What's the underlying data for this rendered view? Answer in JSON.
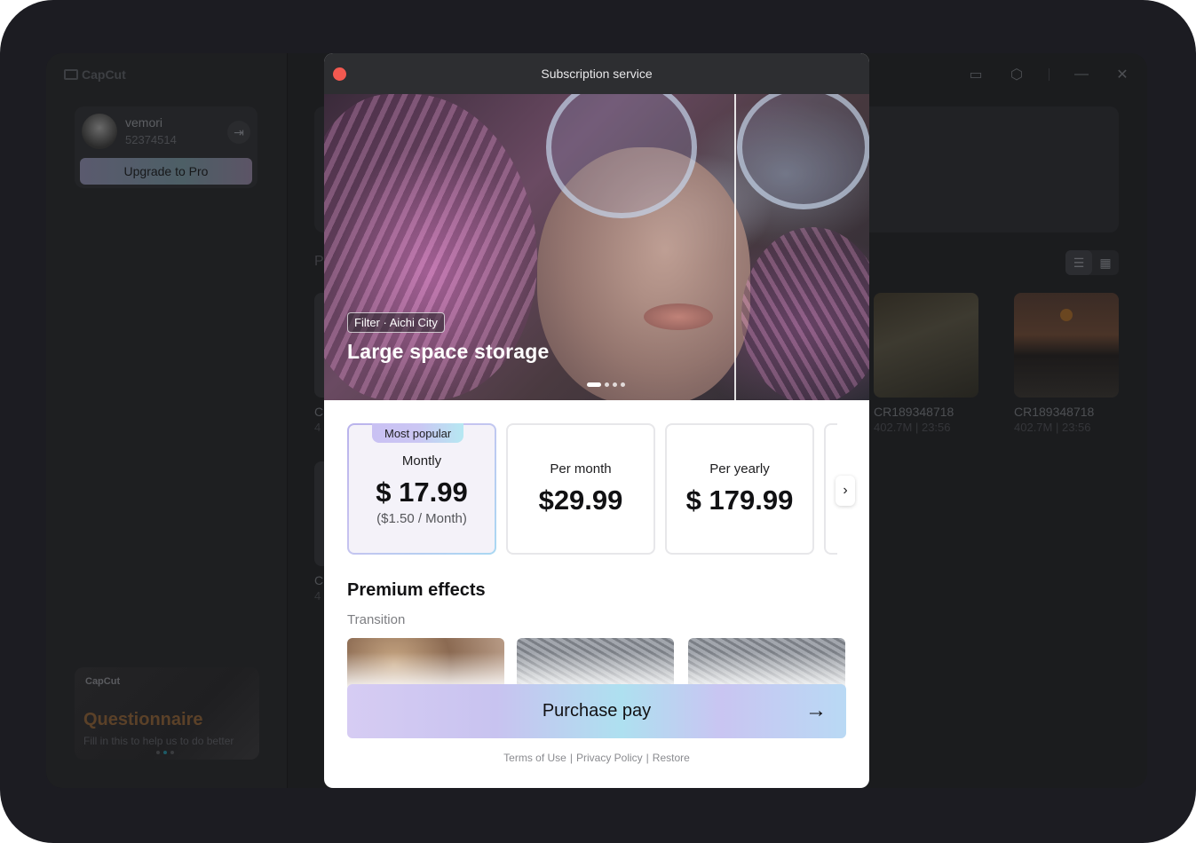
{
  "app": {
    "logo_text": "CapCut",
    "user": {
      "name": "vemori",
      "id": "52374514"
    },
    "upgrade_label": "Upgrade to Pro",
    "section_label_fragment": "P",
    "questionnaire": {
      "logo_text": "CapCut",
      "title": "Questionnaire",
      "subtitle": "Fill in this to help us to do better"
    },
    "projects": [
      {
        "title": "CR189348718",
        "meta": "402.7M | 23:56"
      },
      {
        "title": "CR189348718",
        "meta": "402.7M | 23:56"
      }
    ],
    "left_fragments": [
      "C",
      "4",
      "C",
      "4"
    ],
    "icons": [
      "feedback-icon",
      "settings-icon",
      "minimize-icon",
      "close-icon"
    ]
  },
  "modal": {
    "title": "Subscription service",
    "hero": {
      "tag": "Filter · Aichi City",
      "title": "Large space storage",
      "slides_total": 4,
      "active_slide": 1
    },
    "plans": [
      {
        "badge": "Most popular",
        "name": "Montly",
        "price": "$ 17.99",
        "sub": "($1.50 / Month)",
        "selected": true
      },
      {
        "name": "Per month",
        "price": "$29.99"
      },
      {
        "name": "Per yearly",
        "price": "$ 179.99"
      }
    ],
    "section_title": "Premium effects",
    "section_sub": "Transition",
    "pay_label": "Purchase pay",
    "footer": {
      "terms": "Terms of Use",
      "privacy": "Privacy Policy",
      "restore": "Restore"
    },
    "colors": {
      "close_dot": "#f25950",
      "header_bg": "#2d2e31",
      "accent_start": "#c9c1f3",
      "accent_end": "#aee0f0"
    }
  }
}
